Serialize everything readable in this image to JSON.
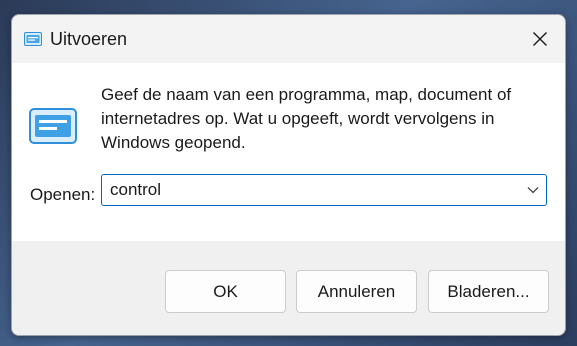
{
  "window": {
    "title": "Uitvoeren",
    "title_icon": "run-icon",
    "close_icon": "close-icon"
  },
  "dialog": {
    "icon": "run-app-icon",
    "description": "Geef de naam van een programma, map, document of internetadres op. Wat u opgeeft, wordt vervolgens in Windows geopend.",
    "open_label": "Openen:",
    "open_input_value": "control",
    "dropdown_icon": "chevron-down-icon"
  },
  "buttons": {
    "ok": "OK",
    "cancel": "Annuleren",
    "browse": "Bladeren..."
  },
  "colors": {
    "accent": "#0067c0",
    "icon_blue": "#2f8fd8"
  }
}
